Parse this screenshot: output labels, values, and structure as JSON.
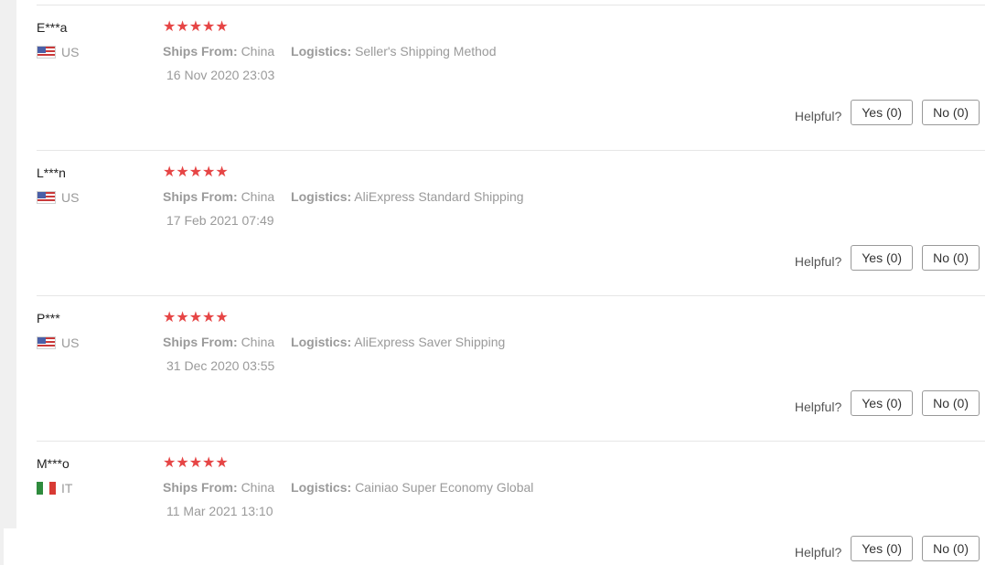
{
  "colors": {
    "star": "#e64545",
    "muted_text": "#9a9a9a",
    "divider": "#e6e6e6"
  },
  "helpful_label": "Helpful?",
  "reviews": [
    {
      "user": "E***a",
      "country": "US",
      "flag_icon": "us-flag-icon",
      "rating": 5,
      "stars": "★★★★★",
      "ships_from_label": "Ships From:",
      "ships_from": "China",
      "logistics_label": "Logistics:",
      "logistics": "Seller's Shipping Method",
      "date": "16 Nov 2020 23:03",
      "yes_label": "Yes (0)",
      "no_label": "No (0)"
    },
    {
      "user": "L***n",
      "country": "US",
      "flag_icon": "us-flag-icon",
      "rating": 5,
      "stars": "★★★★★",
      "ships_from_label": "Ships From:",
      "ships_from": "China",
      "logistics_label": "Logistics:",
      "logistics": "AliExpress Standard Shipping",
      "date": "17 Feb 2021 07:49",
      "yes_label": "Yes (0)",
      "no_label": "No (0)"
    },
    {
      "user": "P***",
      "country": "US",
      "flag_icon": "us-flag-icon",
      "rating": 5,
      "stars": "★★★★★",
      "ships_from_label": "Ships From:",
      "ships_from": "China",
      "logistics_label": "Logistics:",
      "logistics": "AliExpress Saver Shipping",
      "date": "31 Dec 2020 03:55",
      "yes_label": "Yes (0)",
      "no_label": "No (0)"
    },
    {
      "user": "M***o",
      "country": "IT",
      "flag_icon": "italy-flag-icon",
      "rating": 5,
      "stars": "★★★★★",
      "ships_from_label": "Ships From:",
      "ships_from": "China",
      "logistics_label": "Logistics:",
      "logistics": "Cainiao Super Economy Global",
      "date": "11 Mar 2021 13:10",
      "yes_label": "Yes (0)",
      "no_label": "No (0)"
    }
  ]
}
